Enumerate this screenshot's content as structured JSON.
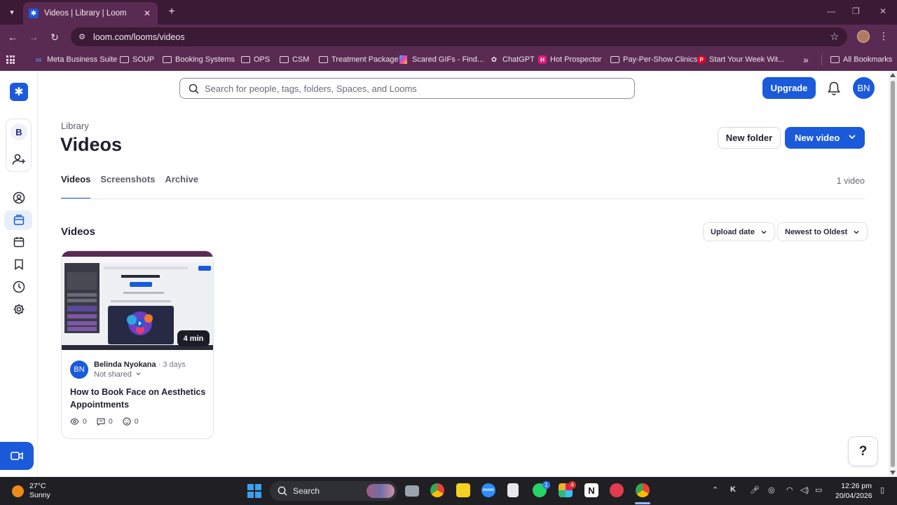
{
  "browser": {
    "tab_title": "Videos | Library | Loom",
    "url": "loom.com/looms/videos",
    "bookmarks": [
      {
        "label": "Meta Business Suite",
        "icon": "meta-icon"
      },
      {
        "label": "SOUP",
        "icon": "folder-icon"
      },
      {
        "label": "Booking Systems",
        "icon": "folder-icon"
      },
      {
        "label": "OPS",
        "icon": "folder-icon"
      },
      {
        "label": "CSM",
        "icon": "folder-icon"
      },
      {
        "label": "Treatment Package",
        "icon": "folder-icon"
      },
      {
        "label": "Scared GIFs - Find...",
        "icon": "gif-icon"
      },
      {
        "label": "ChatGPT",
        "icon": "chatgpt-icon"
      },
      {
        "label": "Hot Prospector",
        "icon": "hot-prospector-icon"
      },
      {
        "label": "Pay-Per-Show Clinics",
        "icon": "folder-icon"
      },
      {
        "label": "Start Your Week Wit...",
        "icon": "pinterest-icon"
      }
    ],
    "more_label": "»",
    "all_bookmarks": "All Bookmarks"
  },
  "app": {
    "search_placeholder": "Search for people, tags, folders, Spaces, and Looms",
    "upgrade_label": "Upgrade",
    "user_initials": "BN",
    "workspace_initial": "B",
    "breadcrumb": "Library",
    "page_title": "Videos",
    "new_folder_label": "New folder",
    "new_video_label": "New video",
    "tabs": [
      {
        "label": "Videos",
        "active": true
      },
      {
        "label": "Screenshots",
        "active": false
      },
      {
        "label": "Archive",
        "active": false
      }
    ],
    "video_count": "1 video",
    "section_title": "Videos",
    "sort_field": "Upload date",
    "sort_order": "Newest to Oldest",
    "help_label": "?",
    "accent_color": "#1a5adb"
  },
  "video": {
    "duration": "4 min",
    "author_initials": "BN",
    "author": "Belinda Nyokana",
    "separator": "·",
    "age": "3 days",
    "share_status": "Not shared",
    "title": "How to Book Face on Aesthetics Appointments",
    "views": "0",
    "comments": "0",
    "reactions": "0"
  },
  "taskbar": {
    "temperature": "27°C",
    "condition": "Sunny",
    "search_label": "Search",
    "time": "12:26 pm",
    "date": "20/04/2026",
    "whatsapp_badge": "1",
    "slack_badge": "4"
  }
}
